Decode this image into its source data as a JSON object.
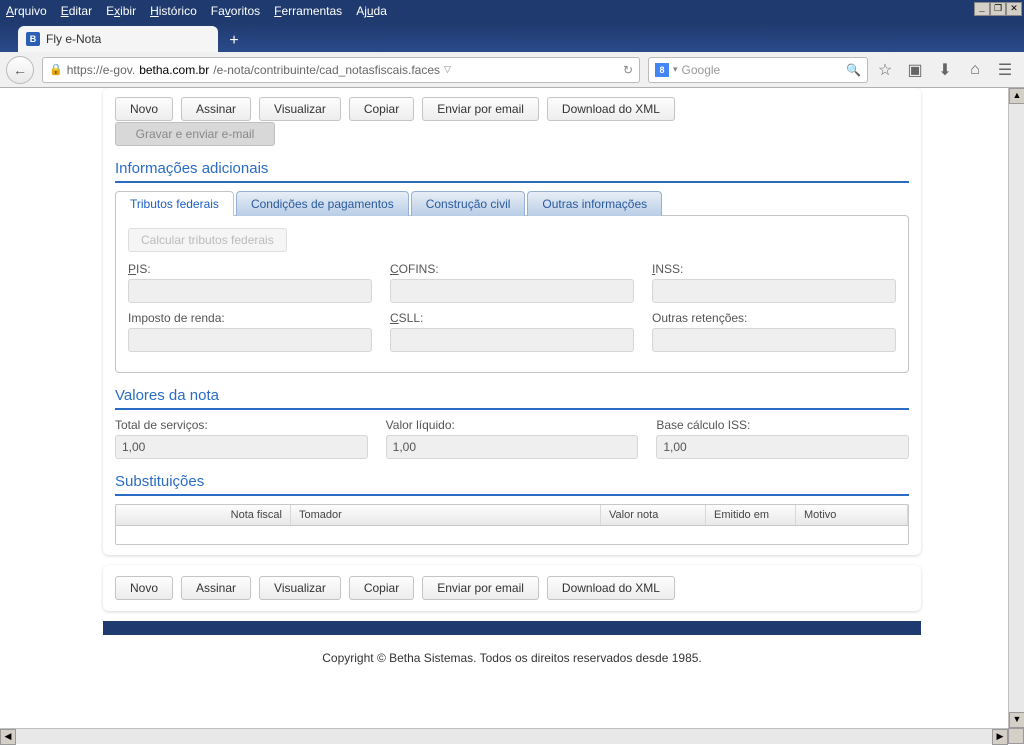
{
  "menus": {
    "arquivo": "Arquivo",
    "editar": "Editar",
    "exibir": "Exibir",
    "historico": "Histórico",
    "favoritos": "Favoritos",
    "ferramentas": "Ferramentas",
    "ajuda": "Ajuda"
  },
  "tab_title": "Fly e-Nota",
  "url_prefix": "https://e-gov.",
  "url_domain": "betha.com.br",
  "url_path": "/e-nota/contribuinte/cad_notasfiscais.faces",
  "search_placeholder": "Google",
  "toolbar": {
    "novo": "Novo",
    "assinar": "Assinar",
    "visualizar": "Visualizar",
    "copiar": "Copiar",
    "enviar": "Enviar por email",
    "download": "Download do XML",
    "gravar_enviar": "Gravar e enviar e-mail"
  },
  "sections": {
    "info_adicionais": "Informações adicionais",
    "valores_nota": "Valores da nota",
    "substituicoes": "Substituições"
  },
  "tabs": {
    "tributos": "Tributos federais",
    "condicoes": "Condições de pagamentos",
    "construcao": "Construção civil",
    "outras": "Outras informações"
  },
  "calc_btn": "Calcular tributos federais",
  "tributos": {
    "pis": {
      "label": "PIS:",
      "ul": "P",
      "rest": "IS:",
      "value": ""
    },
    "cofins": {
      "label": "COFINS:",
      "ul": "C",
      "rest": "OFINS:",
      "value": ""
    },
    "inss": {
      "label": "INSS:",
      "ul": "I",
      "rest": "NSS:",
      "value": ""
    },
    "ir": {
      "label": "Imposto de renda:",
      "value": ""
    },
    "csll": {
      "label": "CSLL:",
      "ul": "C",
      "rest": "SLL:",
      "value": ""
    },
    "outras": {
      "label": "Outras retenções:",
      "value": ""
    }
  },
  "valores": {
    "total": {
      "label": "Total de serviços:",
      "value": "1,00"
    },
    "liquido": {
      "label": "Valor líquido:",
      "value": "1,00"
    },
    "base": {
      "label": "Base cálculo ISS:",
      "value": "1,00"
    }
  },
  "table_headers": {
    "nota": "Nota fiscal",
    "tomador": "Tomador",
    "valor": "Valor nota",
    "emitido": "Emitido em",
    "motivo": "Motivo"
  },
  "copyright": "Copyright © Betha Sistemas. Todos os direitos reservados desde 1985."
}
